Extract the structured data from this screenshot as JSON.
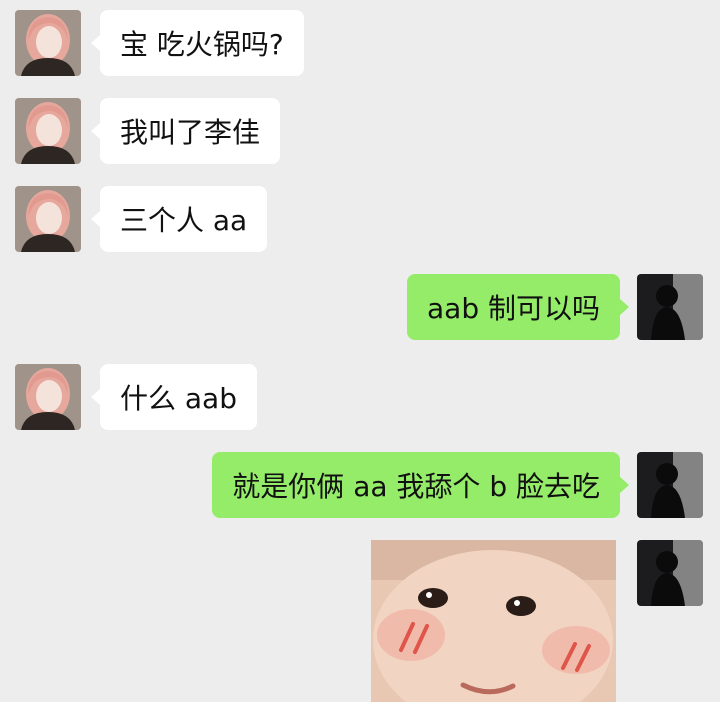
{
  "conversation": {
    "messages": [
      {
        "side": "left",
        "text": "宝 吃火锅吗?"
      },
      {
        "side": "left",
        "text": "我叫了李佳"
      },
      {
        "side": "left",
        "text": "三个人 aa"
      },
      {
        "side": "right",
        "text": "aab 制可以吗"
      },
      {
        "side": "left",
        "text": "什么 aab"
      },
      {
        "side": "right",
        "text": "就是你俩 aa 我舔个 b 脸去吃"
      },
      {
        "side": "right",
        "kind": "sticker"
      }
    ]
  },
  "colors": {
    "chat_background": "#ededed",
    "incoming_bubble": "#ffffff",
    "outgoing_bubble": "#95ec69"
  }
}
